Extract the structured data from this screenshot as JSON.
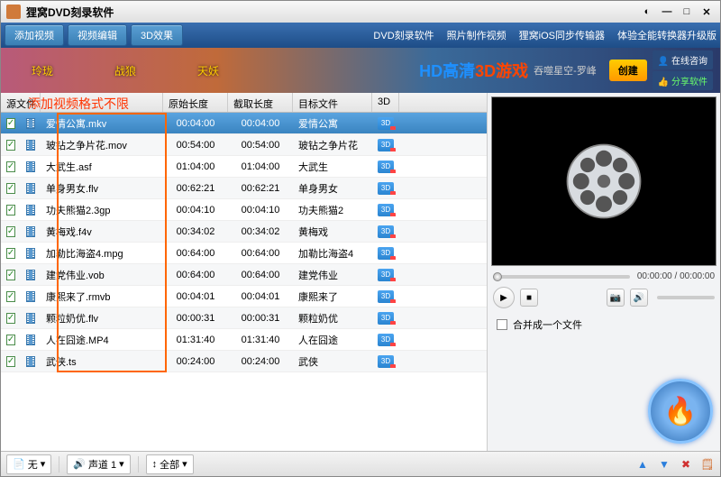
{
  "title": "狸窝DVD刻录软件",
  "menu": {
    "add_video": "添加视频",
    "video_edit": "视频编辑",
    "effect_3d": "3D效果",
    "link1": "DVD刻录软件",
    "link2": "照片制作视频",
    "link3": "狸窝iOS同步传输器",
    "link4": "体验全能转换器升级版"
  },
  "banner": {
    "char1": "玲珑",
    "char2": "战狼",
    "char3": "天妖",
    "hd1": "HD高清",
    "hd2": "3D游戏",
    "sub": "吞噬星空-罗峰",
    "create": "创建",
    "help1": "在线咨询",
    "help2": "分享软件"
  },
  "annotation": "添加视频格式不限",
  "columns": {
    "src": "源文件",
    "orig": "原始长度",
    "cut": "截取长度",
    "target": "目标文件",
    "c3d": "3D"
  },
  "rows": [
    {
      "file": "爱情公寓.mkv",
      "orig": "00:04:00",
      "cut": "00:04:00",
      "target": "爱情公寓",
      "sel": true
    },
    {
      "file": "玻钻之争片花.mov",
      "orig": "00:54:00",
      "cut": "00:54:00",
      "target": "玻钻之争片花"
    },
    {
      "file": "大武生.asf",
      "orig": "01:04:00",
      "cut": "01:04:00",
      "target": "大武生"
    },
    {
      "file": "单身男女.flv",
      "orig": "00:62:21",
      "cut": "00:62:21",
      "target": "单身男女"
    },
    {
      "file": "功夫熊猫2.3gp",
      "orig": "00:04:10",
      "cut": "00:04:10",
      "target": "功夫熊猫2"
    },
    {
      "file": "黄梅戏.f4v",
      "orig": "00:34:02",
      "cut": "00:34:02",
      "target": "黄梅戏"
    },
    {
      "file": "加勒比海盗4.mpg",
      "orig": "00:64:00",
      "cut": "00:64:00",
      "target": "加勒比海盗4"
    },
    {
      "file": "建党伟业.vob",
      "orig": "00:64:00",
      "cut": "00:64:00",
      "target": "建党伟业"
    },
    {
      "file": "康熙来了.rmvb",
      "orig": "00:04:01",
      "cut": "00:04:01",
      "target": "康熙来了"
    },
    {
      "file": "颗粒奶优.flv",
      "orig": "00:00:31",
      "cut": "00:00:31",
      "target": "颗粒奶优"
    },
    {
      "file": "人在囧途.MP4",
      "orig": "01:31:40",
      "cut": "01:31:40",
      "target": "人在囧途"
    },
    {
      "file": "武侠.ts",
      "orig": "00:24:00",
      "cut": "00:24:00",
      "target": "武侠"
    }
  ],
  "preview": {
    "time": "00:00:00 / 00:00:00"
  },
  "merge_label": "合并成一个文件",
  "bottom": {
    "subtitle": "无",
    "audio": "声道 1",
    "range": "全部"
  }
}
